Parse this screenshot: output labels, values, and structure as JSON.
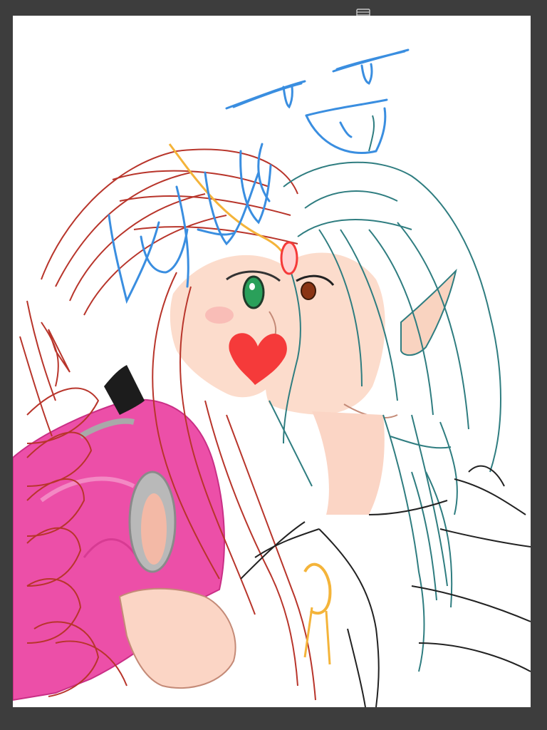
{
  "app": {
    "background_color": "#3d3d3d",
    "canvas_color": "#ffffff"
  },
  "toolbar": {
    "toggle_icon": "window-toggle-icon"
  },
  "artwork": {
    "colors": {
      "red_lineart": "#b8352b",
      "teal_lineart": "#2f7d80",
      "blue_sketch": "#3a8ee0",
      "pink_dress": "#ec4fa8",
      "skin": "#fbd9c8",
      "heart": "#f53a3a",
      "gold": "#f4b43a",
      "choker": "#1c1c1c",
      "silver": "#a9a9a9",
      "green_eye": "#2aa05a",
      "brown_eye": "#8a3414",
      "black_lineart": "#222222"
    }
  }
}
